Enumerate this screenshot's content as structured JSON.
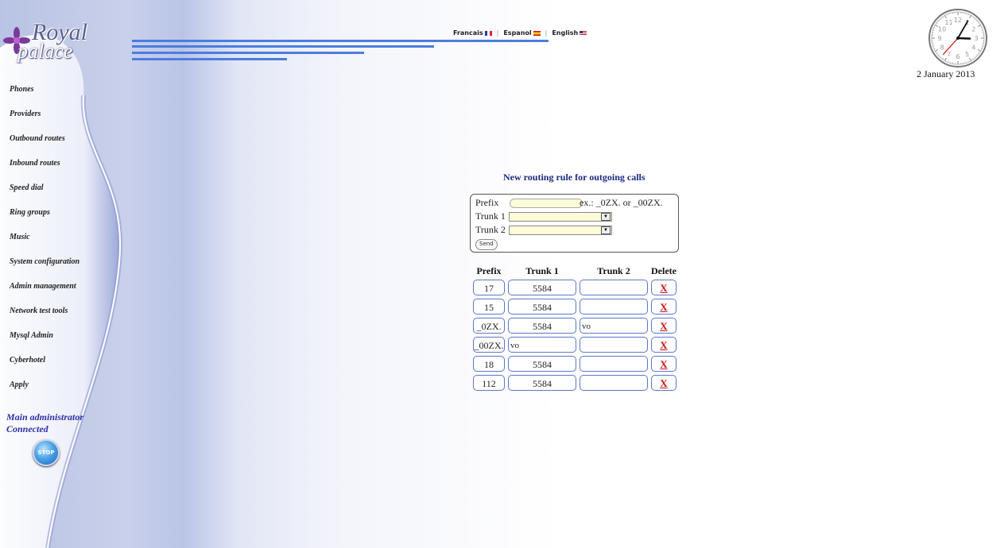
{
  "app": {
    "logo_line1": "Royal",
    "logo_line2": "palace"
  },
  "nav": [
    {
      "label": "Phones"
    },
    {
      "label": "Providers"
    },
    {
      "label": "Outbound routes"
    },
    {
      "label": "Inbound routes"
    },
    {
      "label": "Speed dial"
    },
    {
      "label": "Ring groups"
    },
    {
      "label": "Music"
    },
    {
      "label": "System configuration"
    },
    {
      "label": "Admin management"
    },
    {
      "label": "Network test tools"
    },
    {
      "label": "Mysql Admin"
    },
    {
      "label": "Cyberhotel"
    },
    {
      "label": "Apply"
    }
  ],
  "status": {
    "line1": "Main administrator",
    "line2": "Connected",
    "stop_label": "STOP"
  },
  "languages": [
    {
      "label": "Francais",
      "flag": "fr"
    },
    {
      "label": "Espanol",
      "flag": "es"
    },
    {
      "label": "English",
      "flag": "us"
    }
  ],
  "clock": {
    "date": "2 January 2013",
    "hour": 3,
    "minute": 5,
    "second": 37
  },
  "form": {
    "title": "New routing rule for outgoing calls",
    "prefix_label": "Prefix",
    "prefix_value": "",
    "example": "ex.:   _0ZX. or _00ZX.",
    "trunk1_label": "Trunk 1",
    "trunk1_value": "",
    "trunk2_label": "Trunk 2",
    "trunk2_value": "",
    "send_label": "Send"
  },
  "table": {
    "headers": {
      "prefix": "Prefix",
      "trunk1": "Trunk 1",
      "trunk2": "Trunk 2",
      "delete": "Delete"
    },
    "delete_glyph": "X",
    "rows": [
      {
        "prefix": "17",
        "trunk1": "5584",
        "trunk2": ""
      },
      {
        "prefix": "15",
        "trunk1": "5584",
        "trunk2": ""
      },
      {
        "prefix": "_0ZX.",
        "trunk1": "5584",
        "trunk2": "vo"
      },
      {
        "prefix": "_00ZX.",
        "trunk1": "vo",
        "trunk2": ""
      },
      {
        "prefix": "18",
        "trunk1": "5584",
        "trunk2": ""
      },
      {
        "prefix": "112",
        "trunk1": "5584",
        "trunk2": ""
      }
    ]
  },
  "colors": {
    "accent": "#4a7de0",
    "title": "#1c2a80",
    "delete": "#cc1111",
    "status": "#2f2fa8"
  }
}
